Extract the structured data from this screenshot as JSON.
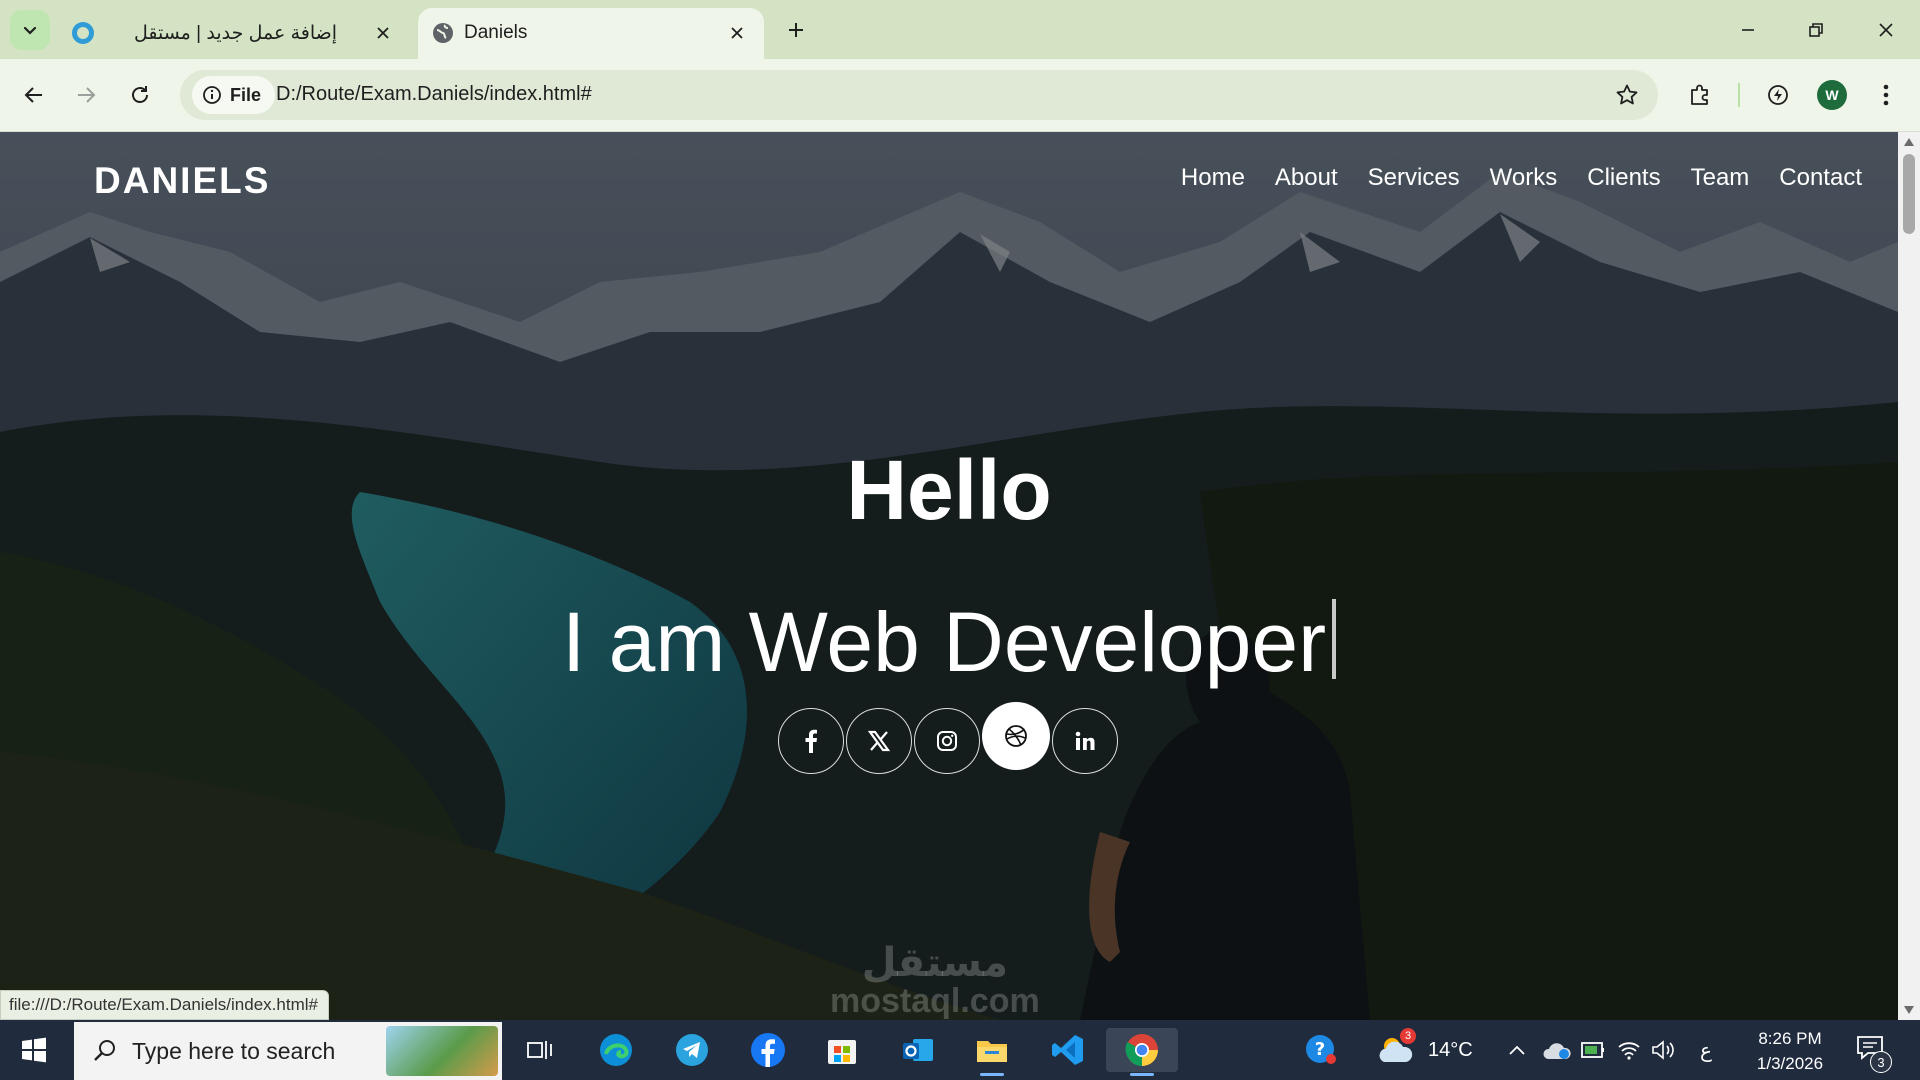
{
  "browser": {
    "tabs": [
      {
        "title": "إضافة عمل جديد | مستقل",
        "active": false
      },
      {
        "title": "Daniels",
        "active": true
      }
    ],
    "chip_label": "File",
    "url": "D:/Route/Exam.Daniels/index.html#",
    "profile_initial": "W",
    "status_url": "file:///D:/Route/Exam.Daniels/index.html#"
  },
  "page": {
    "logo": "DANIELS",
    "nav": [
      "Home",
      "About",
      "Services",
      "Works",
      "Clients",
      "Team",
      "Contact"
    ],
    "hero_title": "Hello",
    "hero_typed": "I am Web Developer",
    "socials": [
      "facebook-icon",
      "x-twitter-icon",
      "instagram-icon",
      "dribbble-icon",
      "linkedin-icon"
    ],
    "active_social": "dribbble-icon",
    "watermark_top": "مستقل",
    "watermark_bottom": "mostaql.com"
  },
  "taskbar": {
    "search_placeholder": "Type here to search",
    "apps": [
      "task-view-icon",
      "edge-icon",
      "telegram-icon",
      "facebook-icon",
      "microsoft-store-icon",
      "outlook-icon",
      "file-explorer-icon",
      "vscode-icon",
      "chrome-icon"
    ],
    "weather_badge": "3",
    "temperature": "14°C",
    "ime": "ع",
    "time": "8:26 PM",
    "date": "1/3/2026",
    "notifications": "3"
  },
  "colors": {
    "tabstrip": "#d3e3c3",
    "toolbar": "#f0f5ea",
    "taskbar": "#202b3d"
  }
}
